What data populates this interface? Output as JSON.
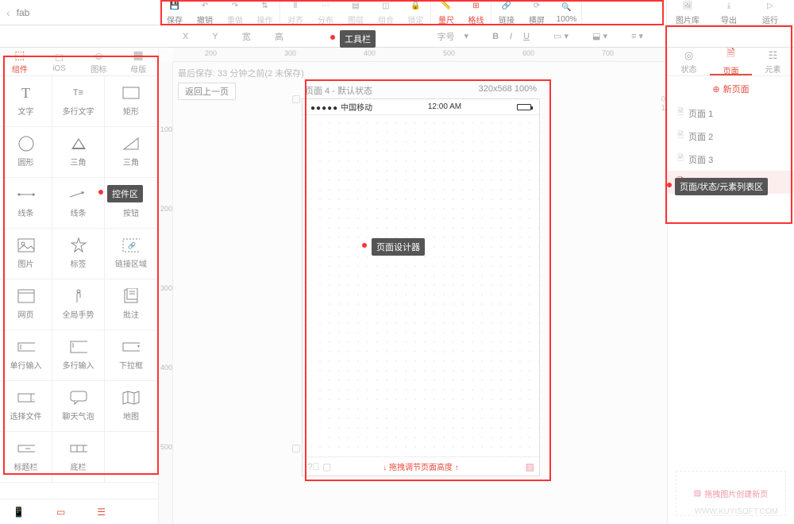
{
  "header": {
    "back_placeholder": "fab"
  },
  "toolbar": {
    "items": [
      {
        "label": "保存",
        "icon": "save"
      },
      {
        "label": "撤销",
        "icon": "undo"
      },
      {
        "label": "重做",
        "icon": "redo",
        "disabled": true
      },
      {
        "label": "操作",
        "icon": "action",
        "disabled": true
      },
      {
        "label": "对齐",
        "icon": "align",
        "disabled": true
      },
      {
        "label": "分布",
        "icon": "distribute",
        "disabled": true
      },
      {
        "label": "图层",
        "icon": "layers",
        "disabled": true
      },
      {
        "label": "组合",
        "icon": "group",
        "disabled": true
      },
      {
        "label": "锁定",
        "icon": "lock",
        "disabled": true
      },
      {
        "label": "量尺",
        "icon": "ruler",
        "active": true
      },
      {
        "label": "格线",
        "icon": "grid",
        "active": true
      },
      {
        "label": "链接",
        "icon": "link"
      },
      {
        "label": "横屏",
        "icon": "rotate"
      },
      {
        "label": "100%",
        "icon": "zoom"
      }
    ],
    "right": [
      {
        "label": "图片库",
        "icon": "gallery"
      },
      {
        "label": "导出",
        "icon": "export"
      },
      {
        "label": "运行",
        "icon": "play"
      }
    ]
  },
  "propbar": {
    "x_label": "X",
    "y_label": "Y",
    "w_label": "宽",
    "h_label": "高",
    "font_label": "字号",
    "bold": "B",
    "italic": "I",
    "underline": "U"
  },
  "left_tabs": [
    {
      "label": "组件",
      "icon": "cube",
      "active": true
    },
    {
      "label": "iOS",
      "icon": "apple"
    },
    {
      "label": "图标",
      "icon": "smile"
    },
    {
      "label": "母版",
      "icon": "layout"
    }
  ],
  "widgets": [
    [
      {
        "label": "文字",
        "shape": "T"
      },
      {
        "label": "多行文字",
        "shape": "multiT"
      },
      {
        "label": "矩形",
        "shape": "rect"
      }
    ],
    [
      {
        "label": "圆形",
        "shape": "circle"
      },
      {
        "label": "三角",
        "shape": "tri"
      },
      {
        "label": "三角",
        "shape": "tri2"
      }
    ],
    [
      {
        "label": "线条",
        "shape": "line"
      },
      {
        "label": "线条",
        "shape": "arrow"
      },
      {
        "label": "按钮",
        "shape": "button"
      }
    ],
    [
      {
        "label": "图片",
        "shape": "image"
      },
      {
        "label": "标签",
        "shape": "star"
      },
      {
        "label": "链接区域",
        "shape": "linkarea"
      }
    ],
    [
      {
        "label": "网页",
        "shape": "web"
      },
      {
        "label": "全局手势",
        "shape": "gesture"
      },
      {
        "label": "批注",
        "shape": "note"
      }
    ],
    [
      {
        "label": "单行输入",
        "shape": "input1"
      },
      {
        "label": "多行输入",
        "shape": "input2"
      },
      {
        "label": "下拉框",
        "shape": "select"
      }
    ],
    [
      {
        "label": "选择文件",
        "shape": "file"
      },
      {
        "label": "聊天气泡",
        "shape": "chat"
      },
      {
        "label": "地图",
        "shape": "map"
      }
    ],
    [
      {
        "label": "标题栏",
        "shape": "titlebar"
      },
      {
        "label": "底栏",
        "shape": "tabbar"
      },
      {
        "label": "",
        "shape": ""
      }
    ]
  ],
  "canvas": {
    "save_info": "最后保存: 33 分钟之前(2 未保存)",
    "back_btn": "返回上一页",
    "page_title": "页面 4 - 默认状态",
    "page_dim": "320x568 100%",
    "carrier": "中国移动",
    "time": "12:00 AM",
    "drag_hint": "拖拽调节页面高度",
    "h_ticks": [
      "200",
      "300",
      "400",
      "500",
      "600",
      "700"
    ],
    "v_ticks": [
      "100",
      "200",
      "300",
      "400",
      "500"
    ],
    "line_nums": [
      "0",
      "1"
    ]
  },
  "right_tabs": [
    {
      "label": "状态",
      "icon": "target"
    },
    {
      "label": "页面",
      "icon": "page",
      "active": true
    },
    {
      "label": "元素",
      "icon": "elements"
    }
  ],
  "new_page_label": "新页面",
  "pages": [
    {
      "label": "页面 1"
    },
    {
      "label": "页面 2"
    },
    {
      "label": "页面 3"
    },
    {
      "label": "页面 4",
      "active": true
    }
  ],
  "drag_new": "拖拽图片创建新页",
  "annotations": {
    "toolbar": "工具栏",
    "controls": "控件区",
    "designer": "页面设计器",
    "pagelist": "页面/状态/元素列表区"
  },
  "watermark": "WWW.KUYISOFT.COM"
}
